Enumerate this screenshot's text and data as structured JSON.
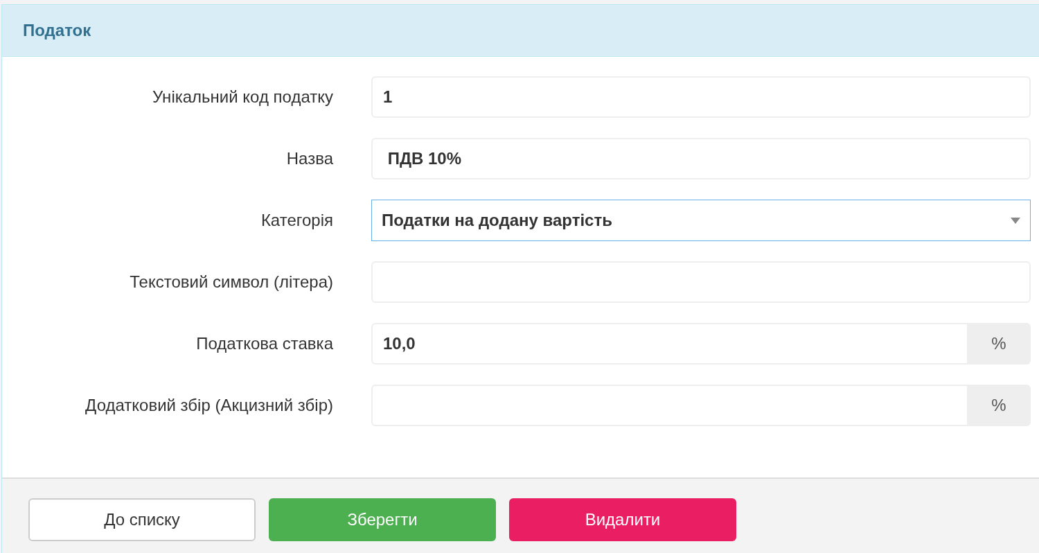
{
  "panel": {
    "title": "Податок"
  },
  "fields": [
    {
      "label": "Унікальний код податку",
      "kind": "text",
      "value": "1",
      "focused": false
    },
    {
      "label": "Назва",
      "kind": "text",
      "value": " ПДВ 10%",
      "focused": false
    },
    {
      "label": "Категорія",
      "kind": "select",
      "value": "Податки на додану вартість",
      "focused": true
    },
    {
      "label": "Текстовий символ (літера)",
      "kind": "text",
      "focused": false
    },
    {
      "label": "Податкова ставка",
      "kind": "addon",
      "value": "10,0",
      "addon": "%",
      "focused": false
    },
    {
      "label": "Додатковий збір (Акцизний збір)",
      "kind": "addon",
      "addon": "%",
      "focused": false
    }
  ],
  "buttons": [
    {
      "label": "До списку",
      "kind": "default"
    },
    {
      "label": "Зберегти",
      "kind": "success"
    },
    {
      "label": "Видалити",
      "kind": "danger"
    }
  ]
}
